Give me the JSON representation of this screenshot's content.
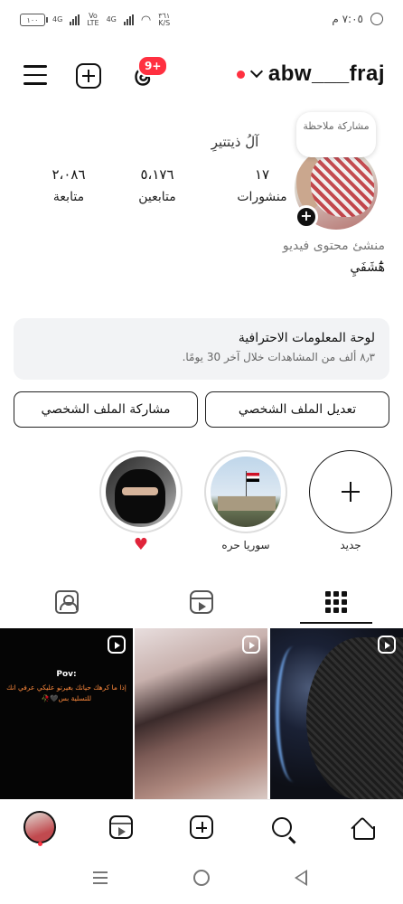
{
  "status_bar": {
    "battery": "١٠٠",
    "net1": "4G",
    "volte": "Vo\nLTE",
    "net2": "4G",
    "speed": "٣٦١\nK/S",
    "time": "٧:٠٥ م"
  },
  "header": {
    "username": "abw___fraj",
    "notification_count": "9+"
  },
  "profile": {
    "note_label": "مشاركة ملاحظة",
    "full_name": "آلُ ذيتتيرِ",
    "stats": [
      {
        "value": "١٧",
        "label": "منشورات"
      },
      {
        "value": "٥،١٧٦",
        "label": "متابعين"
      },
      {
        "value": "٢،٠٨٦",
        "label": "متابعة"
      }
    ],
    "category": "منشئ محتوى فيديو",
    "bio": "هَٰٓٔشَفَيِ"
  },
  "dashboard": {
    "title": "لوحة المعلومات الاحترافية",
    "subtitle": "٨٫٣ ألف من المشاهدات خلال آخر 30 يومًا."
  },
  "buttons": {
    "edit_profile": "تعديل الملف الشخصي",
    "share_profile": "مشاركة الملف الشخصي"
  },
  "highlights": [
    {
      "label": "جديد"
    },
    {
      "label": "سوريا حره"
    },
    {
      "label": "♥"
    }
  ],
  "posts": {
    "pov_title": "Pov:",
    "pov_text": "إذا ما كرهك حياتك بغيرتو عليكي عرفي انك للتسلية بس🖤🥀"
  },
  "colors": {
    "accent_red": "#ff3040",
    "text": "#111111",
    "dashboard_bg": "#f2f3f5"
  }
}
